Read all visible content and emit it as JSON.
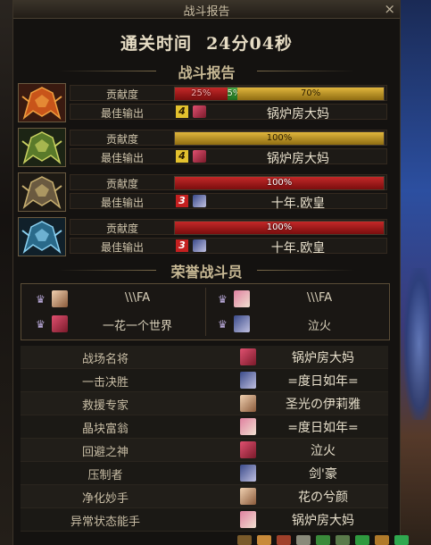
{
  "window": {
    "title": "战斗报告",
    "close_glyph": "×"
  },
  "clear_time": {
    "label": "通关时间",
    "value": "24分04秒"
  },
  "battle_report": {
    "heading": "战斗报告",
    "players": [
      {
        "portrait_icon": "fire-helmet-icon",
        "contribution_label": "贡献度",
        "contribution_segments": [
          {
            "color": "red",
            "percent": 25,
            "text": "25%"
          },
          {
            "color": "green",
            "percent": 5,
            "text": "5%"
          },
          {
            "color": "gold",
            "percent": 70,
            "text": "70%"
          }
        ],
        "best_output_label": "最佳输出",
        "rank": "4",
        "rank_style": "gold",
        "best_player": "锅炉房大妈"
      },
      {
        "portrait_icon": "green-helmet-icon",
        "contribution_label": "贡献度",
        "contribution_segments": [
          {
            "color": "gold",
            "percent": 100,
            "text": "100%"
          }
        ],
        "best_output_label": "最佳输出",
        "rank": "4",
        "rank_style": "gold",
        "best_player": "锅炉房大妈"
      },
      {
        "portrait_icon": "gold-helmet-icon",
        "contribution_label": "贡献度",
        "contribution_segments": [
          {
            "color": "red",
            "percent": 100,
            "text": "100%"
          }
        ],
        "best_output_label": "最佳输出",
        "rank": "3",
        "rank_style": "red",
        "best_player": "十年.欧皇"
      },
      {
        "portrait_icon": "ice-helmet-icon",
        "contribution_label": "贡献度",
        "contribution_segments": [
          {
            "color": "red",
            "percent": 100,
            "text": "100%"
          }
        ],
        "best_output_label": "最佳输出",
        "rank": "3",
        "rank_style": "red",
        "best_player": "十年.欧皇"
      }
    ]
  },
  "honor": {
    "heading": "荣誉战斗员",
    "members": [
      {
        "name": "\\\\\\FA",
        "medal_icon": "medal-icon"
      },
      {
        "name": "\\\\\\FA",
        "medal_icon": "medal-icon"
      },
      {
        "name": "一花一个世界",
        "medal_icon": "medal-icon"
      },
      {
        "name": "泣火",
        "medal_icon": "medal-icon"
      }
    ]
  },
  "awards": [
    {
      "title": "战场名将",
      "player": "锅炉房大妈"
    },
    {
      "title": "一击决胜",
      "player": "=度日如年="
    },
    {
      "title": "救援专家",
      "player": "圣光の伊莉雅"
    },
    {
      "title": "晶块富翁",
      "player": "=度日如年="
    },
    {
      "title": "回避之神",
      "player": "泣火"
    },
    {
      "title": "压制者",
      "player": "剑'豪"
    },
    {
      "title": "净化妙手",
      "player": "花の兮颜"
    },
    {
      "title": "异常状态能手",
      "player": "锅炉房大妈"
    }
  ],
  "colors": {
    "bar_red": "#c42828",
    "bar_green": "#4fb84a",
    "bar_gold": "#e0b63c",
    "rank_gold": "#e3c12e",
    "rank_red": "#c42020"
  }
}
